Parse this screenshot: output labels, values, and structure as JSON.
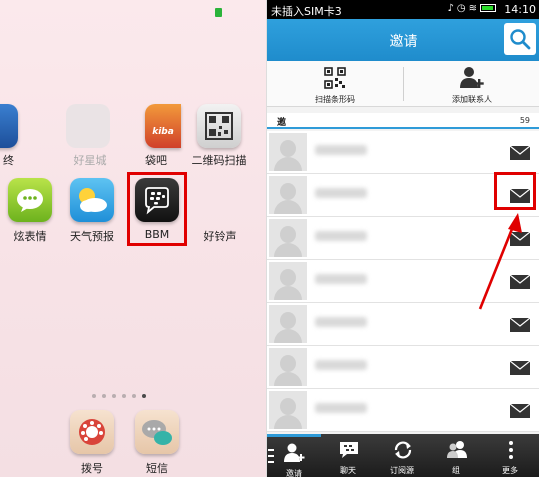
{
  "home": {
    "top_labels": [
      "终",
      "好星城",
      "袋吧",
      "二维码扫描"
    ],
    "apps": [
      {
        "name": "炫表情"
      },
      {
        "name": "天气预报"
      },
      {
        "name": "BBM"
      },
      {
        "name": "好铃声"
      }
    ],
    "dock": [
      {
        "name": "拨号"
      },
      {
        "name": "短信"
      }
    ],
    "kiba_text": "kiba"
  },
  "status_bar": {
    "carrier": "未插入SIM卡3",
    "time": "14:10"
  },
  "header": {
    "title": "邀请"
  },
  "actions": {
    "scan": "扫描条形码",
    "add_contact": "添加联系人"
  },
  "section": {
    "header": "邀",
    "count": "59"
  },
  "contacts_count_rows": 7,
  "tabbar": {
    "items": [
      {
        "label": "邀请"
      },
      {
        "label": "聊天"
      },
      {
        "label": "订阅源"
      },
      {
        "label": "组"
      },
      {
        "label": "更多"
      }
    ]
  },
  "colors": {
    "accent_blue": "#1f8ccc",
    "highlight_red": "#e00000"
  }
}
